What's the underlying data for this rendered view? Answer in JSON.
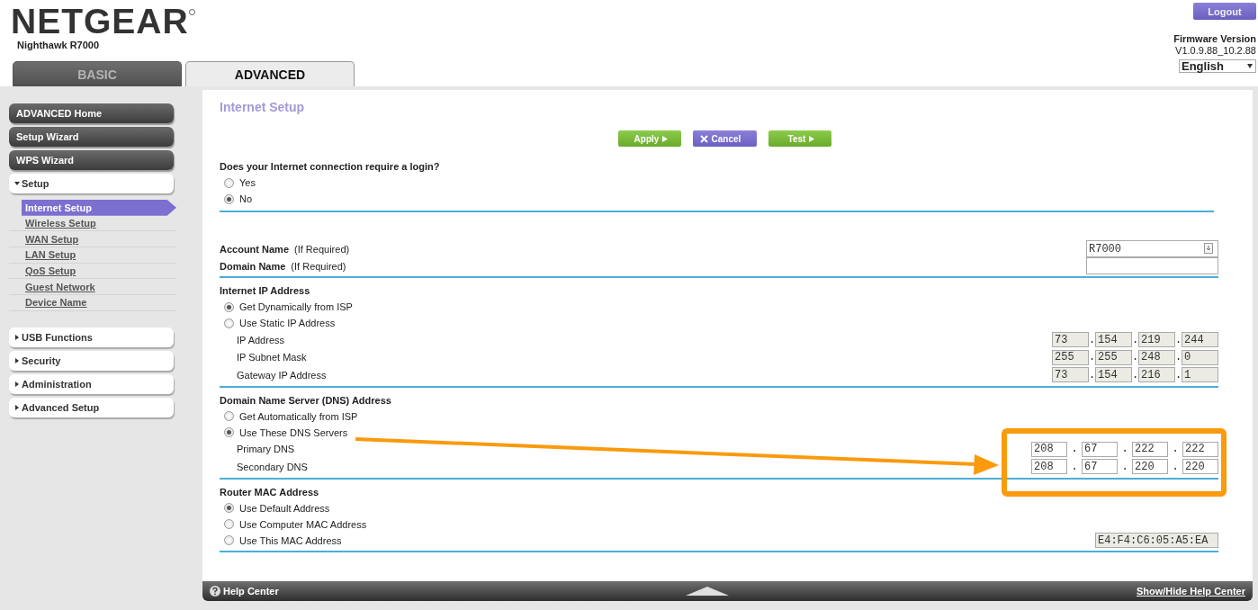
{
  "header": {
    "logo": "NETGEAR",
    "model": "Nighthawk R7000",
    "logout": "Logout",
    "firmware_label": "Firmware Version",
    "firmware_version": "V1.0.9.88_10.2.88",
    "language": "English"
  },
  "tabs": [
    {
      "label": "BASIC",
      "selected": false
    },
    {
      "label": "ADVANCED",
      "selected": true
    }
  ],
  "sidebar": {
    "items": [
      {
        "label": "ADVANCED Home",
        "kind": "button"
      },
      {
        "label": "Setup Wizard",
        "kind": "button"
      },
      {
        "label": "WPS Wizard",
        "kind": "button"
      },
      {
        "label": "Setup",
        "kind": "group",
        "expanded": true,
        "children": [
          {
            "label": "Internet Setup",
            "selected": true
          },
          {
            "label": "Wireless Setup",
            "selected": false
          },
          {
            "label": "WAN Setup",
            "selected": false
          },
          {
            "label": "LAN Setup",
            "selected": false
          },
          {
            "label": "QoS Setup",
            "selected": false
          },
          {
            "label": "Guest Network",
            "selected": false
          },
          {
            "label": "Device Name",
            "selected": false
          }
        ]
      },
      {
        "label": "USB Functions",
        "kind": "group",
        "expanded": false
      },
      {
        "label": "Security",
        "kind": "group",
        "expanded": false
      },
      {
        "label": "Administration",
        "kind": "group",
        "expanded": false
      },
      {
        "label": "Advanced Setup",
        "kind": "group",
        "expanded": false
      }
    ]
  },
  "page": {
    "title": "Internet Setup",
    "buttons": [
      {
        "label": "Apply",
        "kind": "go"
      },
      {
        "label": "Cancel",
        "kind": "cancel"
      },
      {
        "label": "Test",
        "kind": "go"
      }
    ],
    "sections": [
      {
        "heading": "Does your Internet connection require a login?",
        "rows": [
          {
            "kind": "radio",
            "label": "Yes",
            "selected": false
          },
          {
            "kind": "radio",
            "label": "No",
            "selected": true
          }
        ]
      },
      {
        "rows": [
          {
            "kind": "text",
            "label": "Account Name",
            "hint": "(If Required)",
            "value": "R7000"
          },
          {
            "kind": "text",
            "label": "Domain Name",
            "hint": "(If Required)"
          }
        ]
      },
      {
        "heading": "Internet IP Address",
        "rows": [
          {
            "kind": "radio",
            "label": "Get Dynamically from ISP",
            "selected": true
          },
          {
            "kind": "radio",
            "label": "Use Static IP Address",
            "selected": false
          },
          {
            "kind": "ip",
            "label": "IP Address",
            "disabled": true,
            "octets": [
              "73",
              "154",
              "219",
              "244"
            ],
            "separators": [
              ".",
              ".",
              "."
            ]
          },
          {
            "kind": "ip",
            "label": "IP Subnet Mask",
            "disabled": true,
            "octets": [
              "255",
              "255",
              "248",
              "0"
            ],
            "separators": [
              ".",
              ".",
              "."
            ]
          },
          {
            "kind": "ip",
            "label": "Gateway IP Address",
            "disabled": true,
            "octets": [
              "73",
              "154",
              "216",
              "1"
            ],
            "separators": [
              ".",
              ".",
              "."
            ]
          }
        ]
      },
      {
        "heading": "Domain Name Server (DNS) Address",
        "rows": [
          {
            "kind": "radio",
            "label": "Get Automatically from ISP",
            "selected": false
          },
          {
            "kind": "radio",
            "label": "Use These DNS Servers",
            "selected": true
          },
          {
            "kind": "ip",
            "label": "Primary DNS",
            "disabled": false,
            "octets": [
              "208",
              "67",
              "222",
              "222"
            ],
            "separators": [
              ".",
              ".",
              "."
            ]
          },
          {
            "kind": "ip",
            "label": "Secondary DNS",
            "disabled": false,
            "octets": [
              "208",
              "67",
              "220",
              "220"
            ],
            "separators": [
              ".",
              ".",
              "."
            ]
          }
        ]
      },
      {
        "heading": "Router MAC Address",
        "rows": [
          {
            "kind": "radio",
            "label": "Use Default Address",
            "selected": true
          },
          {
            "kind": "radio",
            "label": "Use Computer MAC Address",
            "selected": false
          },
          {
            "kind": "radio",
            "label": "Use This MAC Address",
            "selected": false,
            "value": "E4:F4:C6:05:A5:EA",
            "disabled": true
          }
        ]
      }
    ]
  },
  "help_bar": {
    "help": "Help Center",
    "toggle": "Show/Hide Help Center"
  }
}
